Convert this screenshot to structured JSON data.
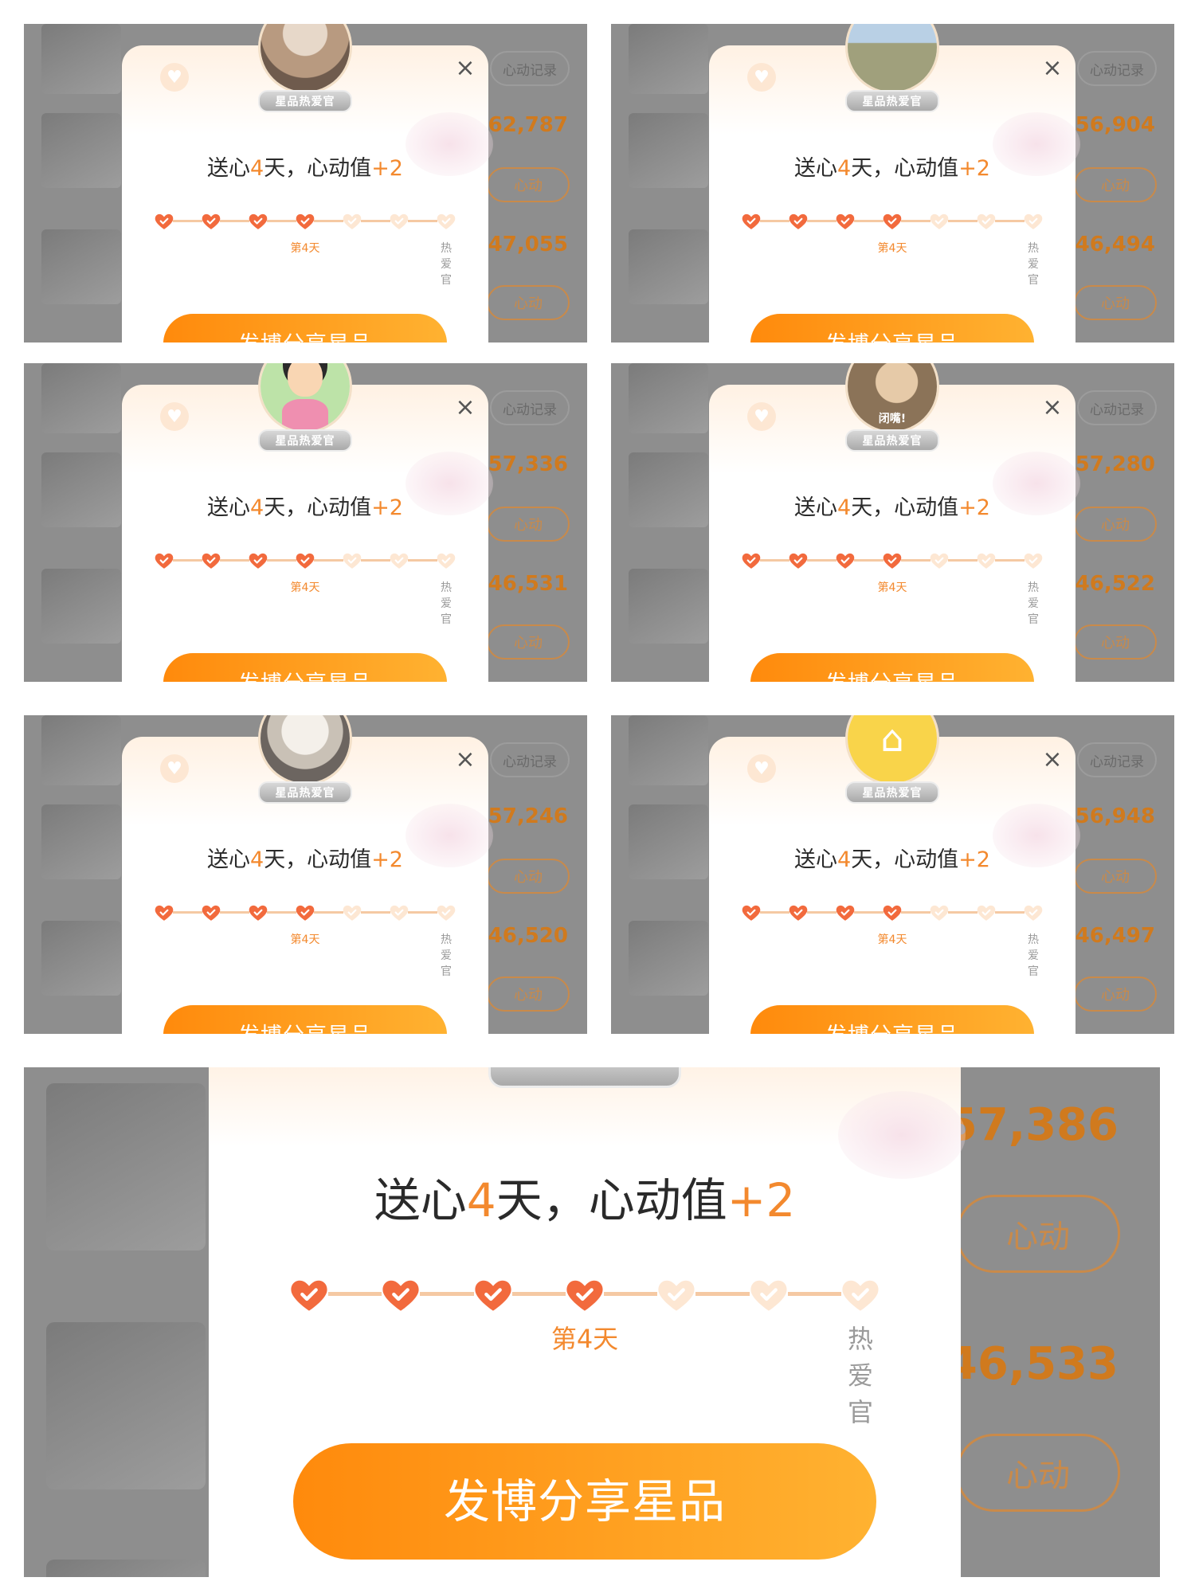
{
  "popup": {
    "title_prefix": "送心",
    "days": "4",
    "title_mid": "天，心动值",
    "bonus": "+2",
    "current_label": "第4天",
    "final_label": "热爱官",
    "share_button": "发博分享星品",
    "badge": "星品热爱官",
    "close_glyph": "×",
    "steps_total": 7,
    "steps_done": 4
  },
  "list": {
    "record_button": "心动记录",
    "action_button": "心动",
    "heart_glyph": "♡"
  },
  "panels": [
    {
      "avatar": "photo-avatar",
      "count1": "62,787",
      "count2": "47,055"
    },
    {
      "avatar": "road-avatar",
      "count1": "56,904",
      "count2": "46,494"
    },
    {
      "avatar": "cartoon-avatar",
      "count1": "57,336",
      "count2": "46,531"
    },
    {
      "avatar": "hand-avatar",
      "avatar_text": "闭嘴!",
      "count1": "57,280",
      "count2": "46,522"
    },
    {
      "avatar": "cat-avatar",
      "count1": "57,246",
      "count2": "46,520"
    },
    {
      "avatar": "yellow-avatar",
      "count1": "56,948",
      "count2": "46,497"
    }
  ],
  "zoomed": {
    "count1": "57,386",
    "count2": "46,533"
  },
  "colors": {
    "accent": "#f3892e",
    "button_start": "#ff8a0c",
    "button_end": "#ffb231",
    "overlay": "#8e8e8e"
  }
}
